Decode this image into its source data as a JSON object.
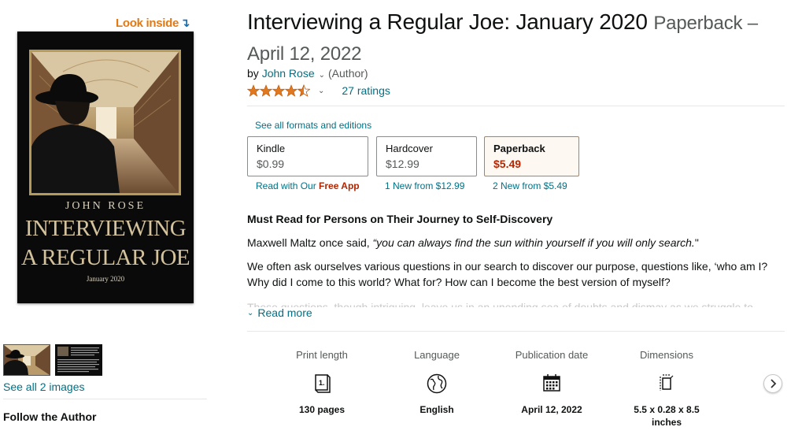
{
  "look_inside": {
    "label": "Look inside"
  },
  "cover": {
    "author": "JOHN ROSE",
    "title_line1": "INTERVIEWING",
    "title_line2": "A REGULAR JOE",
    "date": "January 2020"
  },
  "thumbnails": {
    "see_all": "See all 2 images"
  },
  "follow_author": "Follow the Author",
  "product": {
    "title": "Interviewing a Regular Joe: January 2020",
    "format_line": "Paperback – April 12, 2022",
    "by": "by",
    "author": "John Rose",
    "author_role": "(Author)",
    "rating_value": 4.5,
    "rating_count": "27 ratings"
  },
  "formats": {
    "see_all": "See all formats and editions",
    "options": [
      {
        "name": "Kindle",
        "price": "$0.99",
        "sub_prefix": "Read with Our ",
        "sub_strong": "Free App"
      },
      {
        "name": "Hardcover",
        "price": "$12.99",
        "sub_prefix": "1 New from $12.99",
        "sub_strong": ""
      },
      {
        "name": "Paperback",
        "price": "$5.49",
        "sub_prefix": "2 New from $5.49",
        "sub_strong": ""
      }
    ],
    "selected": "Paperback"
  },
  "description": {
    "heading": "Must Read for Persons on Their Journey to Self-Discovery",
    "p1_prefix": "Maxwell Maltz once said, ",
    "p1_quote": "“you can always find the sun within yourself if you will only search.",
    "p1_suffix": "\"",
    "p2": "We often ask ourselves various questions in our search to discover our purpose, questions like, ‘who am I? Why did I come to this world? What for? How can I become the best version of myself?",
    "p3_faded": "These questions, though intriguing, leave us in an unending sea of doubts and dismay as we struggle to",
    "read_more": "Read more"
  },
  "details": [
    {
      "label": "Print length",
      "icon": "book-page-icon",
      "value": "130 pages"
    },
    {
      "label": "Language",
      "icon": "globe-icon",
      "value": "English"
    },
    {
      "label": "Publication date",
      "icon": "calendar-icon",
      "value": "April 12, 2022"
    },
    {
      "label": "Dimensions",
      "icon": "dimensions-icon",
      "value": "5.5 x 0.28 x 8.5 inches"
    }
  ],
  "colors": {
    "link": "#007185",
    "price_red": "#b12704",
    "selected_border": "#e77600",
    "star": "#de7921",
    "look_inside_orange": "#e47911"
  }
}
